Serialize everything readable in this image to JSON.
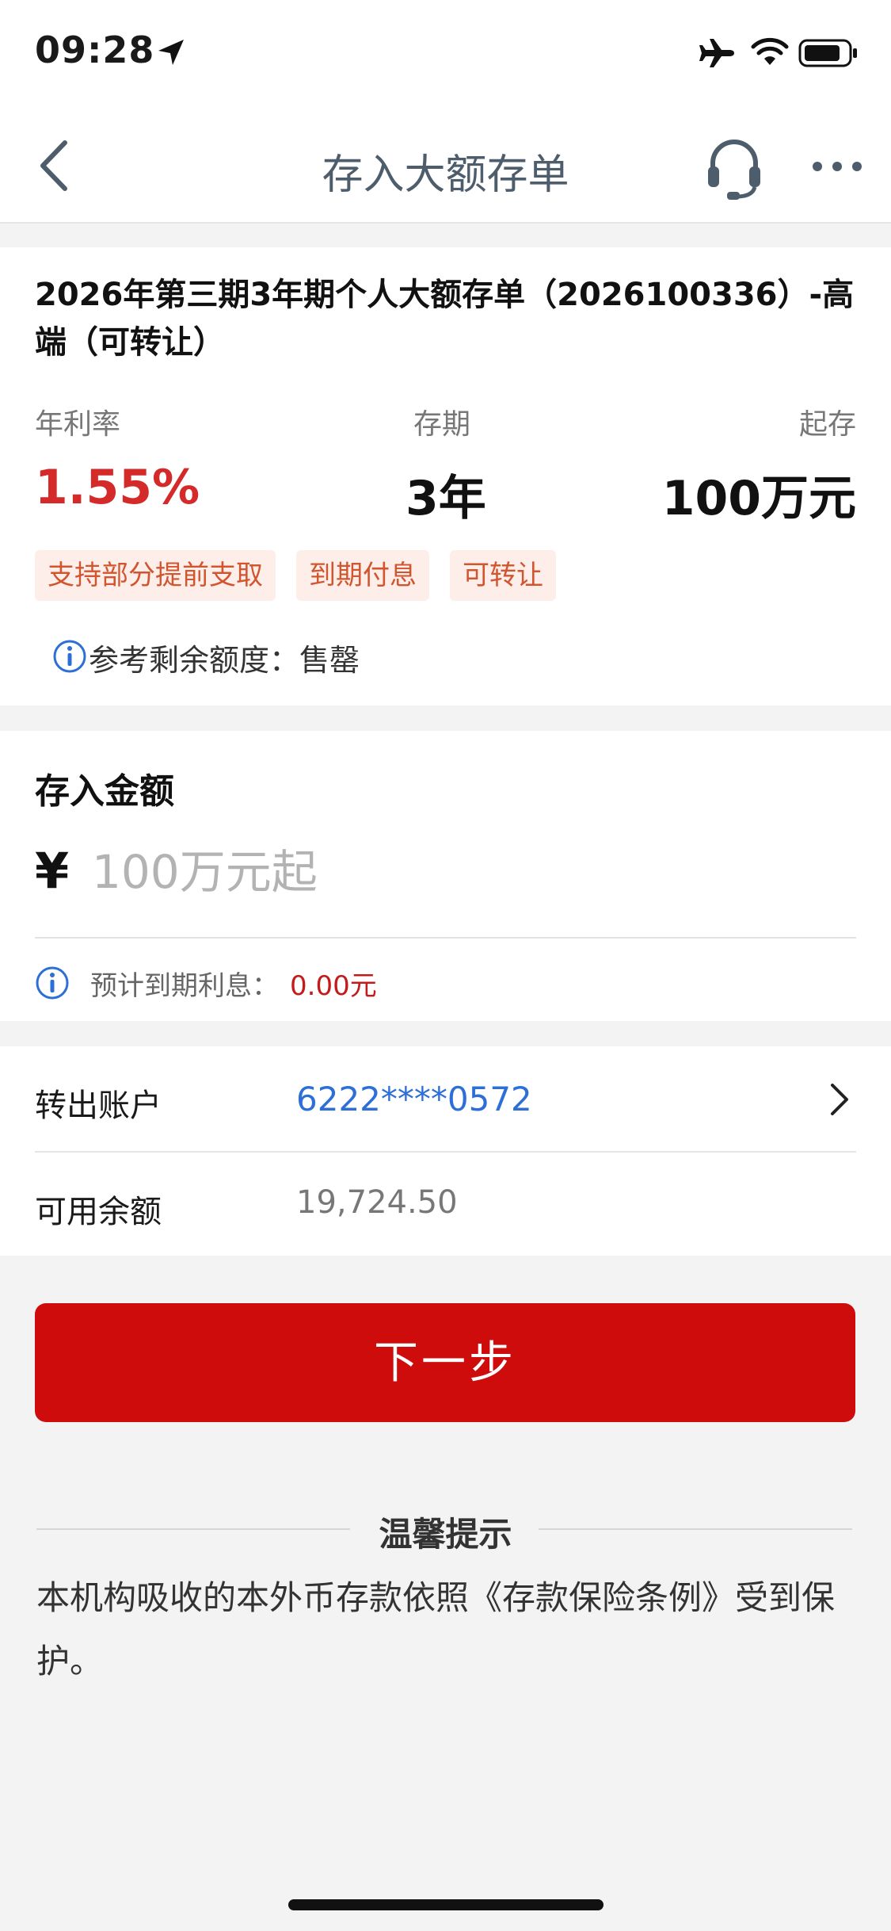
{
  "status_bar": {
    "time": "09:28",
    "icons": [
      "location-arrow-icon",
      "airplane-icon",
      "wifi-icon",
      "battery-icon"
    ]
  },
  "nav": {
    "title": "存入大额存单",
    "icons": [
      "back-icon",
      "headset-icon",
      "more-icon"
    ]
  },
  "product": {
    "name": "2026年第三期3年期个人大额存单（2026100336）-高端（可转让）",
    "rate_label": "年利率",
    "rate_value": "1.55%",
    "term_label": "存期",
    "term_value": "3年",
    "min_label": "起存",
    "min_value": "100万元",
    "tags": [
      "支持部分提前支取",
      "到期付息",
      "可转让"
    ],
    "quota_text": "参考剩余额度：售罄"
  },
  "amount": {
    "title": "存入金额",
    "currency_symbol": "¥",
    "placeholder": "100万元起",
    "value": "",
    "interest_label": "预计到期利息：",
    "interest_value": "0.00元"
  },
  "account": {
    "from_label": "转出账户",
    "from_value": "6222****0572",
    "balance_label": "可用余额",
    "balance_value": "19,724.50"
  },
  "actions": {
    "next_label": "下一步"
  },
  "tips": {
    "title": "温馨提示",
    "text": "本机构吸收的本外币存款依照《存款保险条例》受到保护。"
  },
  "colors": {
    "brand_red": "#cf0c0c",
    "rate_red": "#d42a2a",
    "link_blue": "#2d6fd6",
    "tag_bg": "#fdeeea",
    "tag_text": "#d1552e"
  }
}
